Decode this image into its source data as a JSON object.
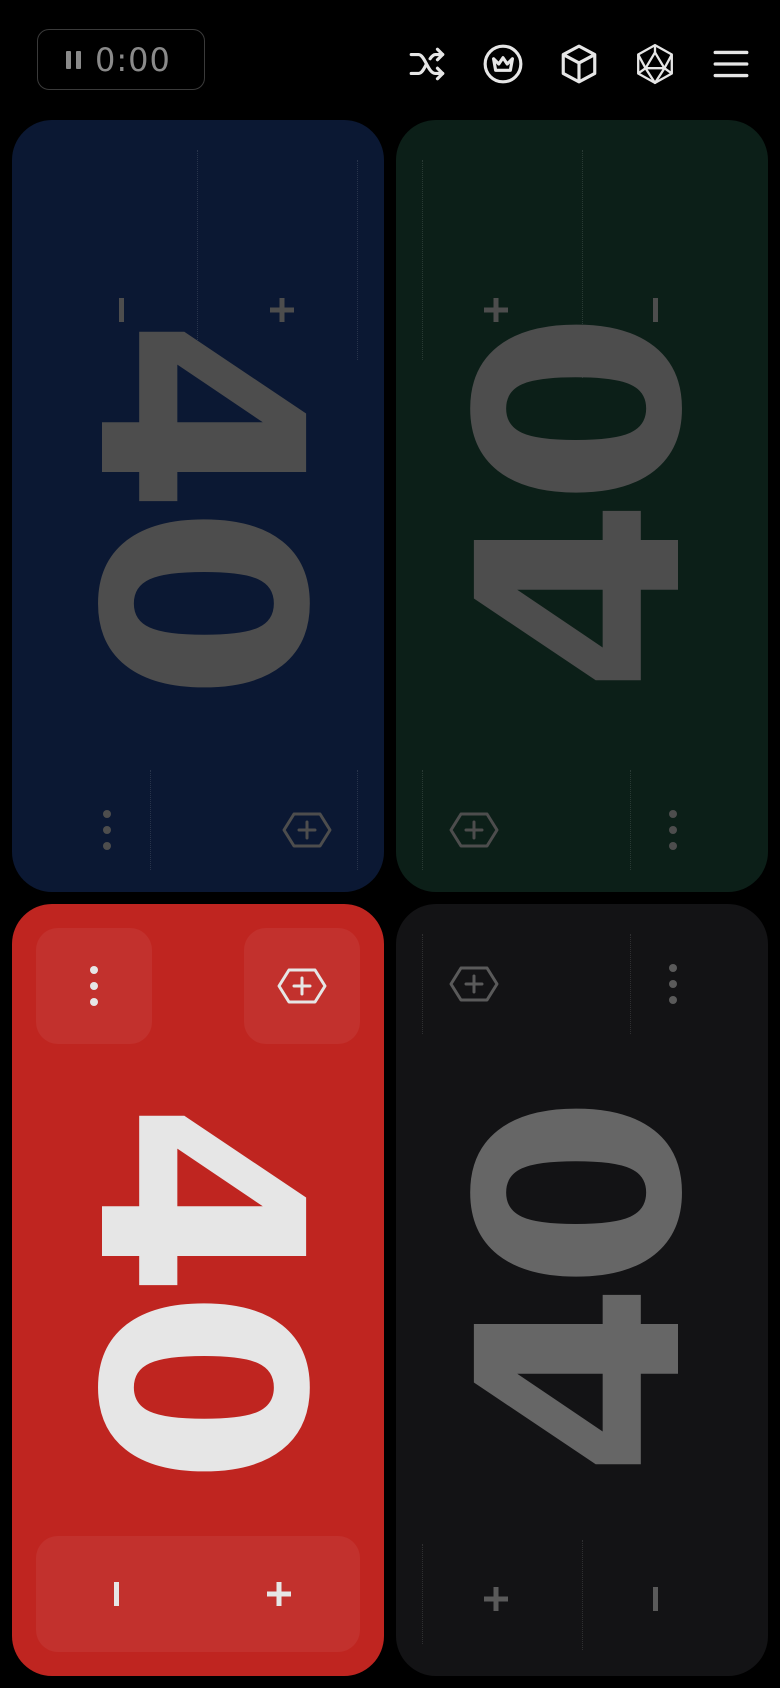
{
  "timer": {
    "value": "0:00",
    "state": "paused"
  },
  "toolbar": {
    "icons": [
      "shuffle-icon",
      "crown-icon",
      "cube-icon",
      "d20-icon",
      "menu-icon"
    ]
  },
  "players": [
    {
      "id": 1,
      "life": "40",
      "color": "#0b1833",
      "text_color": "#4d4d4d",
      "orientation": "rotated-clockwise"
    },
    {
      "id": 2,
      "life": "40",
      "color": "#0c1f18",
      "text_color": "#4d4d4d",
      "orientation": "rotated-counterclockwise"
    },
    {
      "id": 3,
      "life": "40",
      "color": "#bf2520",
      "text_color": "#e6e6e6",
      "orientation": "rotated-clockwise",
      "active": true
    },
    {
      "id": 4,
      "life": "40",
      "color": "#131315",
      "text_color": "#666666",
      "orientation": "rotated-counterclockwise"
    }
  ],
  "controls": {
    "decrement": "minus-icon",
    "increment": "plus-icon",
    "more": "more-vertical-icon",
    "counter": "counter-add-icon"
  }
}
